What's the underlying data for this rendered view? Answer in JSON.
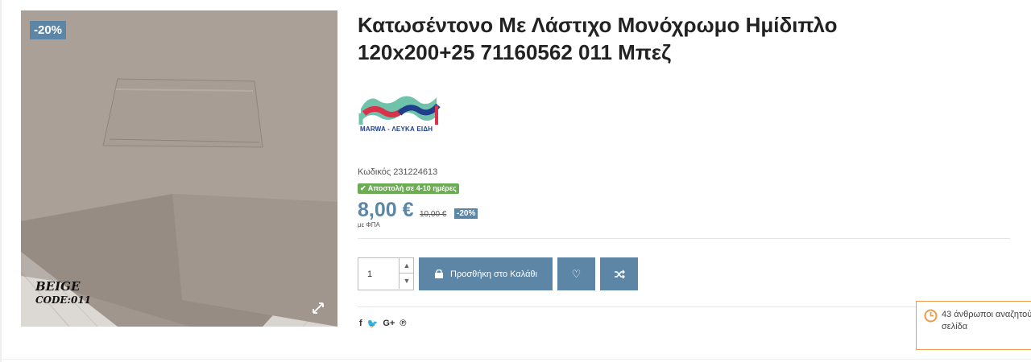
{
  "product": {
    "title_line1": "Κατωσέντονο Με Λάστιχο Μονόχρωμο Ημίδιπλο",
    "title_line2": "120x200+25 71160562 011 Μπεζ",
    "discount_flag": "-20%",
    "image_caption_line1": "BEIGE",
    "image_caption_line2": "CODE:011",
    "brand_text": "MARWA - ΛΕΥΚΑ ΕΙΔΗ",
    "code_line": "Κωδικός 231224613",
    "shipping_badge": "Αποστολή σε 4-10 ημέρες",
    "price": "8,00 €",
    "old_price": "10,00 €",
    "price_discount": "-20%",
    "vat_note": "με ΦΠΑ"
  },
  "cart": {
    "quantity": "1",
    "add_to_cart_label": "Προσθήκη στο Καλάθι"
  },
  "share": {
    "icons": [
      "facebook-icon",
      "twitter-icon",
      "google-plus-icon",
      "pinterest-icon"
    ]
  },
  "notification": {
    "text": "43 άνθρωποι αναζητού σελίδα"
  },
  "colors": {
    "accent": "#5d86a6",
    "shipping_green": "#6cad53",
    "notify_border": "#f19a48"
  }
}
